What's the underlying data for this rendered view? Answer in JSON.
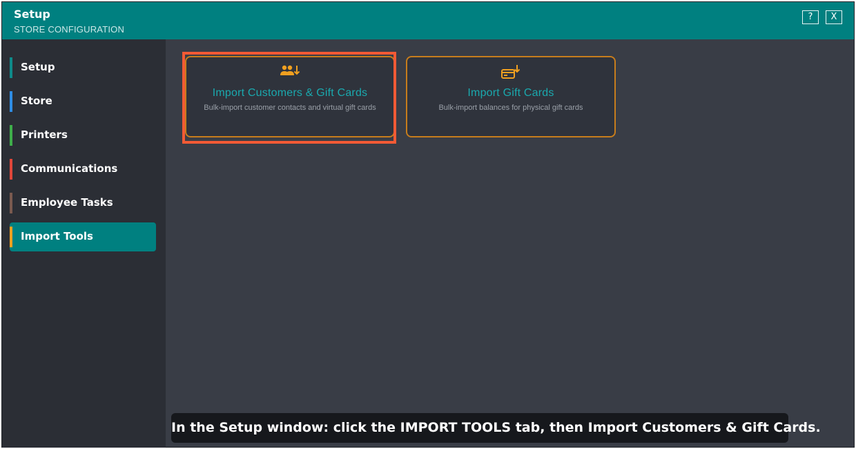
{
  "window": {
    "title": "Setup",
    "subtitle": "STORE CONFIGURATION",
    "help_label": "?",
    "close_label": "X"
  },
  "sidebar": {
    "items": [
      {
        "label": "Setup",
        "color": "#0e8a8a",
        "active": false
      },
      {
        "label": "Store",
        "color": "#2f8de4",
        "active": false
      },
      {
        "label": "Printers",
        "color": "#3fae4a",
        "active": false
      },
      {
        "label": "Communications",
        "color": "#e0463a",
        "active": false
      },
      {
        "label": "Employee Tasks",
        "color": "#7a5a4f",
        "active": false
      },
      {
        "label": "Import Tools",
        "color": "#f0a020",
        "active": true
      }
    ]
  },
  "cards": [
    {
      "title": "Import Customers & Gift Cards",
      "description": "Bulk-import customer contacts and virtual gift cards",
      "icon": "users-import-icon"
    },
    {
      "title": "Import Gift Cards",
      "description": "Bulk-import balances for physical gift cards",
      "icon": "card-import-icon"
    }
  ],
  "caption": "In the Setup window: click the IMPORT TOOLS tab, then Import Customers & Gift Cards.",
  "colors": {
    "accent": "#008080",
    "card_border": "#c77d1c",
    "highlight": "#f25a35",
    "icon": "#f0a020"
  }
}
